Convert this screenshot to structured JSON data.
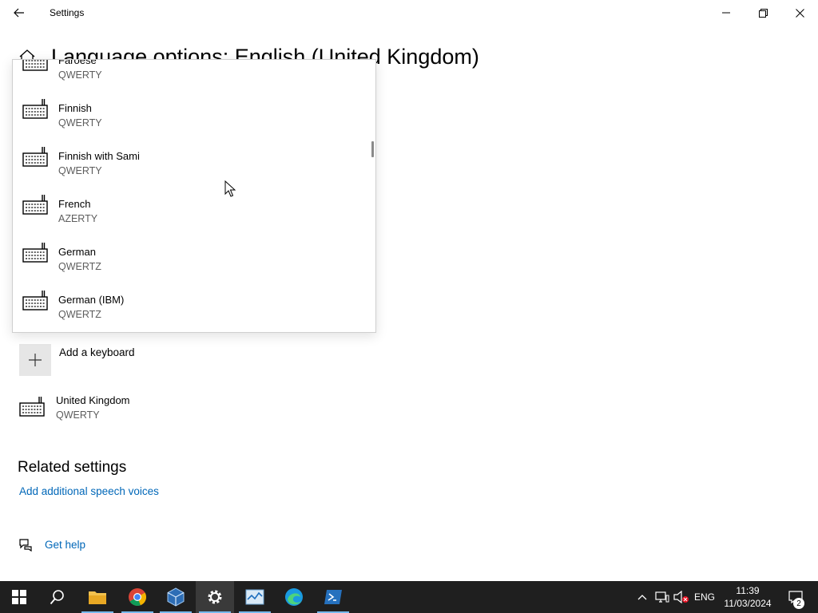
{
  "window": {
    "app_title": "Settings"
  },
  "page": {
    "title": "Language options: English (United Kingdom)"
  },
  "flyout": {
    "items": [
      {
        "name": "Faroese",
        "layout": "QWERTY"
      },
      {
        "name": "Finnish",
        "layout": "QWERTY"
      },
      {
        "name": "Finnish with Sami",
        "layout": "QWERTY"
      },
      {
        "name": "French",
        "layout": "AZERTY"
      },
      {
        "name": "German",
        "layout": "QWERTZ"
      },
      {
        "name": "German (IBM)",
        "layout": "QWERTZ"
      }
    ]
  },
  "keyboards": {
    "add_label": "Add a keyboard",
    "installed": {
      "name": "United Kingdom",
      "layout": "QWERTY"
    }
  },
  "related": {
    "title": "Related settings",
    "speech_link": "Add additional speech voices"
  },
  "help": {
    "label": "Get help"
  },
  "taskbar": {
    "language": "ENG",
    "time": "11:39",
    "date": "11/03/2024",
    "notification_count": "2",
    "apps": [
      "start-icon",
      "search-icon",
      "file-explorer-icon",
      "chrome-icon",
      "virtualbox-icon",
      "settings-icon",
      "task-manager-icon",
      "edge-icon",
      "powershell-icon"
    ]
  },
  "colors": {
    "link": "#0067b8",
    "taskbar": "#1f1f1f",
    "accent": "#76b9ed"
  }
}
